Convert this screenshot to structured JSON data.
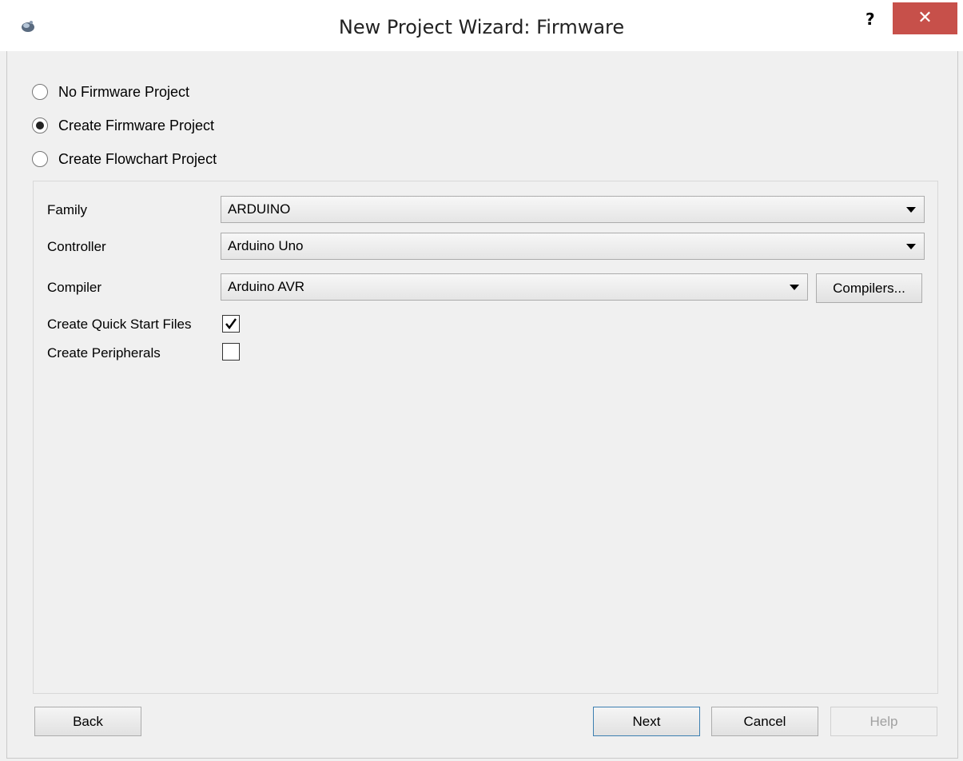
{
  "window": {
    "title": "New Project Wizard: Firmware",
    "help_glyph": "?",
    "close_glyph": "✕"
  },
  "project_type": {
    "options": [
      {
        "label": "No Firmware Project",
        "checked": false
      },
      {
        "label": "Create Firmware Project",
        "checked": true
      },
      {
        "label": "Create Flowchart Project",
        "checked": false
      }
    ]
  },
  "form": {
    "family": {
      "label": "Family",
      "value": "ARDUINO"
    },
    "controller": {
      "label": "Controller",
      "value": "Arduino Uno"
    },
    "compiler": {
      "label": "Compiler",
      "value": "Arduino AVR",
      "button": "Compilers..."
    },
    "quick_start": {
      "label": "Create Quick Start Files",
      "checked": true
    },
    "peripherals": {
      "label": "Create Peripherals",
      "checked": false
    }
  },
  "buttons": {
    "back": "Back",
    "next": "Next",
    "cancel": "Cancel",
    "help": "Help"
  },
  "icons": {
    "app": "app-logo-icon",
    "close": "close-icon",
    "dropdown": "chevron-down-icon",
    "check": "checkmark-icon"
  },
  "colors": {
    "close_button": "#c7504a",
    "default_button_border": "#3c7fb1"
  }
}
